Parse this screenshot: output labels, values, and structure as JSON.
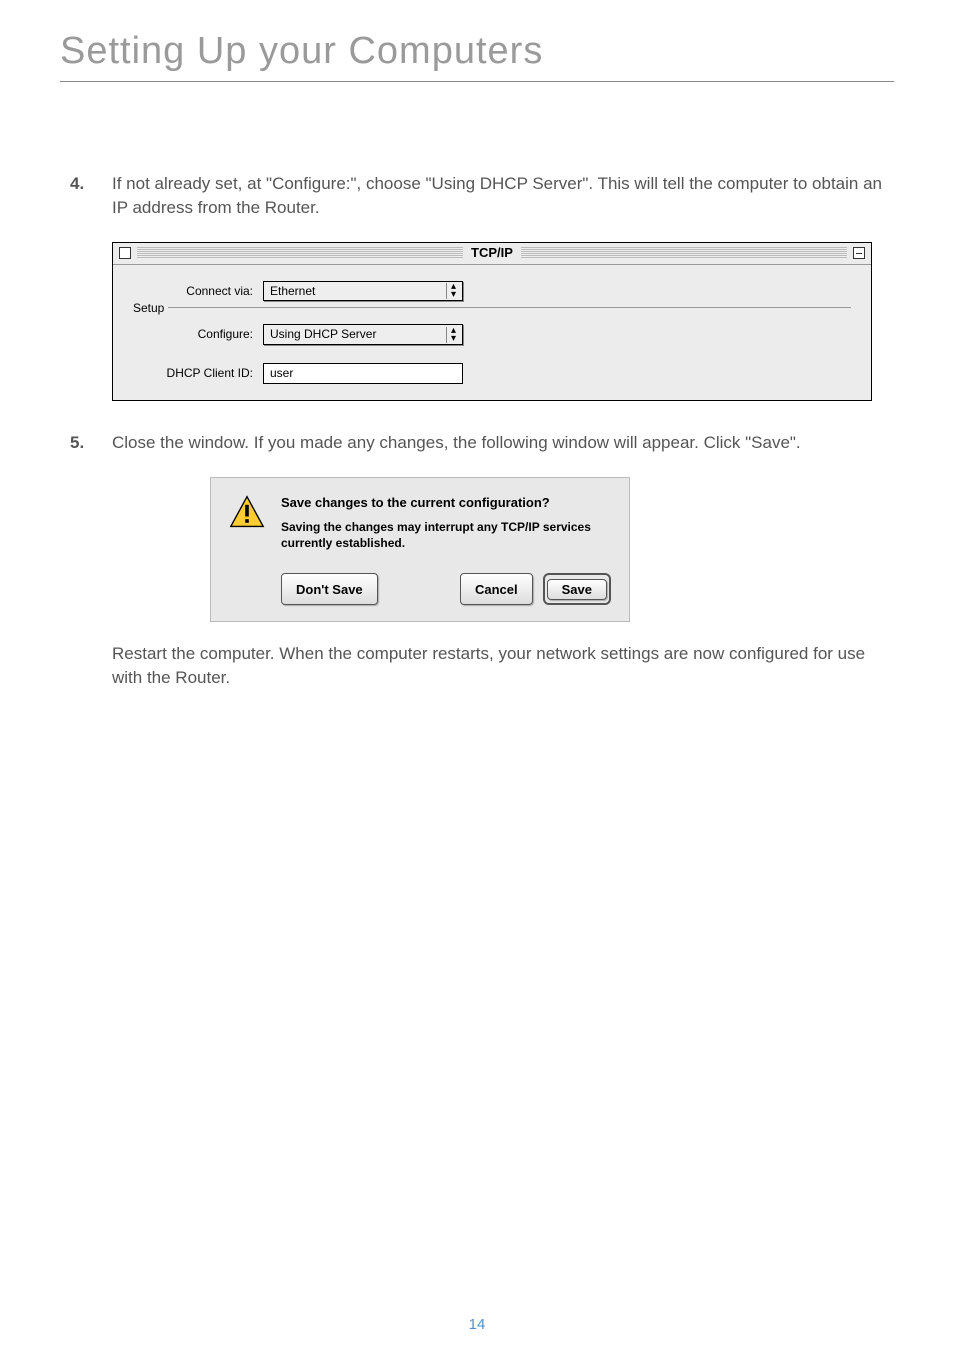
{
  "page": {
    "title": "Setting Up your Computers",
    "number": "14"
  },
  "steps": {
    "s4": {
      "num": "4.",
      "text": "If not already set, at \"Configure:\", choose \"Using DHCP Server\". This will tell the computer to obtain an IP address from the Router."
    },
    "s5": {
      "num": "5.",
      "text": "Close the window. If you made any changes, the following window will appear. Click \"Save\"."
    },
    "restart": "Restart the computer. When the computer restarts, your network settings are now configured for use with the Router."
  },
  "tcpip": {
    "title": "TCP/IP",
    "connect_via_label": "Connect via:",
    "connect_via_value": "Ethernet",
    "setup_legend": "Setup",
    "configure_label": "Configure:",
    "configure_value": "Using DHCP Server",
    "dhcp_client_label": "DHCP Client ID:",
    "dhcp_client_value": "user"
  },
  "dialog": {
    "icon": "warning-icon",
    "title": "Save changes to the current configuration?",
    "desc": "Saving the changes may interrupt any TCP/IP services currently established.",
    "dont_save": "Don't Save",
    "cancel": "Cancel",
    "save": "Save"
  }
}
